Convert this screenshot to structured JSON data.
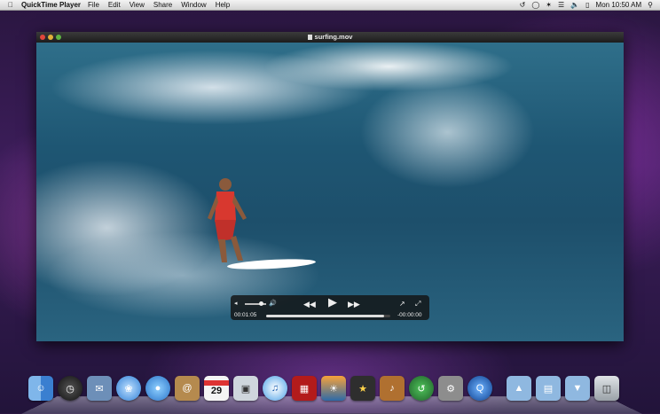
{
  "menubar": {
    "app_name": "QuickTime Player",
    "menus": [
      "File",
      "Edit",
      "View",
      "Share",
      "Window",
      "Help"
    ],
    "clock": "Mon 10:50 AM"
  },
  "window": {
    "title": "surfing.mov"
  },
  "controller": {
    "elapsed": "00:01:05",
    "remaining": "-00:00:00",
    "progress": 0.95,
    "volume": 0.75
  },
  "dock": {
    "items": [
      "finder-icon",
      "dashboard-icon",
      "mail-icon",
      "safari-icon",
      "ichat-icon",
      "address-book-icon",
      "ical-icon",
      "preview-icon",
      "itunes-icon",
      "photo-booth-icon",
      "iphoto-icon",
      "imovie-icon",
      "garageband-icon",
      "time-machine-icon",
      "system-preferences-icon",
      "quicktime-icon",
      "applications-folder-icon",
      "documents-folder-icon",
      "downloads-folder-icon",
      "trash-icon"
    ],
    "calendar_day": "29"
  },
  "colors": {
    "traffic_red": "#e0463c",
    "traffic_yellow": "#e2b03a",
    "traffic_green": "#5fb443"
  }
}
